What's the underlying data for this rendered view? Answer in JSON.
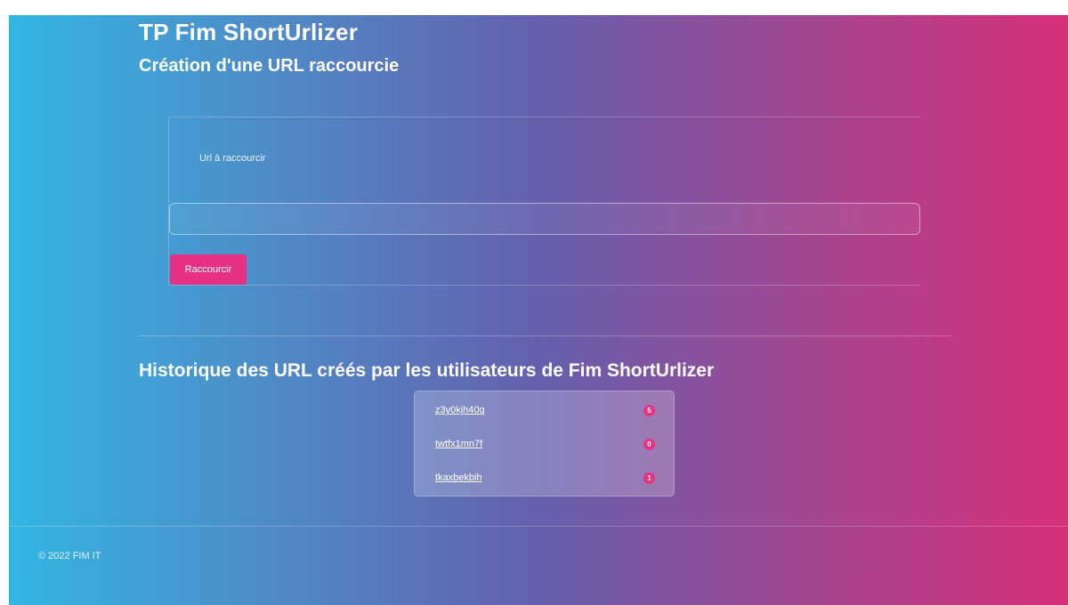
{
  "header": {
    "app_title": "TP Fim ShortUrlizer",
    "page_subtitle": "Création d'une URL raccourcie"
  },
  "form": {
    "url_label": "Url à raccourcir",
    "url_value": "",
    "submit_label": "Raccourcir"
  },
  "history": {
    "title": "Historique des URL créés par les utilisateurs de",
    "title_brand": "Fim ShortUrlizer",
    "items": [
      {
        "code": "z3y0kjh40q",
        "count": "5"
      },
      {
        "code": "twtfx1mn7f",
        "count": "0"
      },
      {
        "code": "tkaxbekbih",
        "count": "1"
      }
    ]
  },
  "footer": {
    "copyright": "© 2022 FIM IT"
  },
  "colors": {
    "gradient_start": "#33b6e2",
    "gradient_end": "#d82f7a",
    "accent": "#e83183"
  }
}
